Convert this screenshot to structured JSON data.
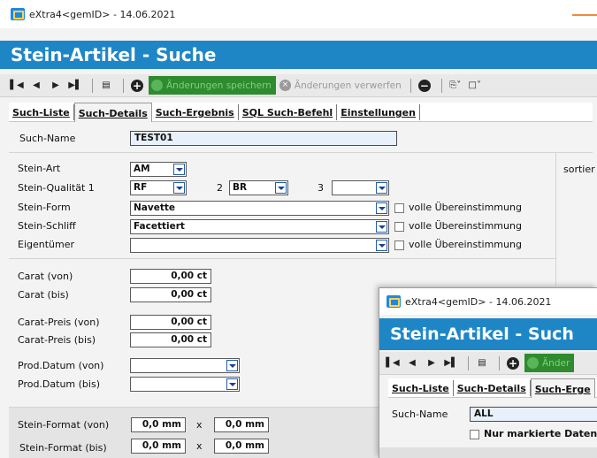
{
  "window1": {
    "title": "eXtra4<gemID>  -  14.06.2021",
    "header": "Stein-Artikel  -  Suche",
    "toolbar": {
      "save_label": "Änderungen speichern",
      "discard_label": "Änderungen verwerfen"
    },
    "tabs": [
      "Such-Liste",
      "Such-Details",
      "Such-Ergebnis",
      "SQL Such-Befehl",
      "Einstellungen"
    ],
    "active_tab": "Such-Details",
    "form": {
      "such_name_label": "Such-Name",
      "such_name_value": "TEST01",
      "stein_art_label": "Stein-Art",
      "stein_art_value": "AM",
      "qualitaet_label": "Stein-Qualität 1",
      "qualitaet_1_value": "RF",
      "qualitaet_2_label": "2",
      "qualitaet_2_value": "BR",
      "qualitaet_3_label": "3",
      "qualitaet_3_value": "",
      "form_label": "Stein-Form",
      "form_value": "Navette",
      "schliff_label": "Stein-Schliff",
      "schliff_value": "Facettiert",
      "eigentuemer_label": "Eigentümer",
      "eigentuemer_value": "",
      "volle_label": "volle Übereinstimmung",
      "carat_von_label": "Carat (von)",
      "carat_von_value": "0,00 ct",
      "carat_bis_label": "Carat (bis)",
      "carat_bis_value": "0,00 ct",
      "preis_von_label": "Carat-Preis (von)",
      "preis_von_value": "0,00 ct",
      "preis_bis_label": "Carat-Preis (bis)",
      "preis_bis_value": "0,00 ct",
      "datum_von_label": "Prod.Datum (von)",
      "datum_von_value": "",
      "datum_bis_label": "Prod.Datum (bis)",
      "datum_bis_value": "",
      "format_von_label": "Stein-Format (von)",
      "format_von_a": "0,0 mm",
      "format_von_b": "0,0 mm",
      "format_bis_label": "Stein-Format (bis)",
      "format_bis_a": "0,0 mm",
      "format_bis_b": "0,0 mm",
      "times": "x",
      "sort_label": "sortier"
    }
  },
  "window2": {
    "title": "eXtra4<gemID>  -  14.06.2021",
    "header": "Stein-Artikel  -  Such",
    "toolbar": {
      "save_label": "Änder"
    },
    "tabs": [
      "Such-Liste",
      "Such-Details",
      "Such-Erge"
    ],
    "active_tab": "Such-Erge",
    "such_name_label": "Such-Name",
    "such_name_value": "ALL",
    "nur_markierte_label": "Nur markierte Datensä"
  },
  "colors": {
    "header_blue": "#1f86c6",
    "save_green": "#2e8b2e",
    "accent_orange": "#f08a3a"
  }
}
